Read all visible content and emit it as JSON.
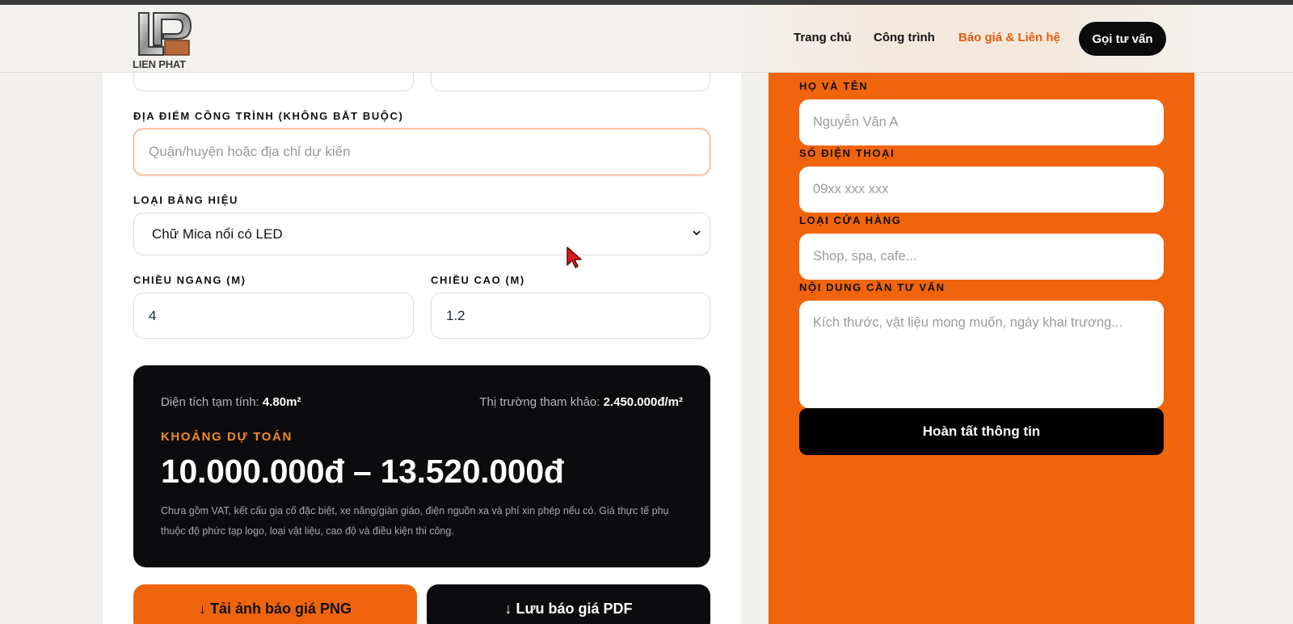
{
  "header": {
    "logo_text": "LIEN PHAT",
    "nav": [
      {
        "label": "Trang chủ"
      },
      {
        "label": "Công trình"
      },
      {
        "label": "Báo giá & Liên hệ"
      }
    ],
    "cta_label": "Gọi tư vấn"
  },
  "form": {
    "location_label": "ĐỊA ĐIỂM CÔNG TRÌNH (KHÔNG BẮT BUỘC)",
    "location_placeholder": "Quận/huyện hoặc địa chỉ dự kiến",
    "sign_type_label": "LOẠI BẢNG HIỆU",
    "sign_type_value": "Chữ Mica nổi có LED",
    "width_label": "CHIỀU NGANG (M)",
    "width_value": "4",
    "height_label": "CHIỀU CAO (M)",
    "height_value": "1.2"
  },
  "estimate": {
    "area_label": "Diện tích tạm tính:",
    "area_value": "4.80m²",
    "market_label": "Thị trường tham khảo:",
    "market_value": "2.450.000đ/m²",
    "title": "KHOẢNG DỰ TOÁN",
    "range": "10.000.000đ – 13.520.000đ",
    "note": "Chưa gồm VAT, kết cấu gia cố đặc biệt, xe nâng/giàn giáo, điện nguồn xa và phí xin phép nếu có. Giá thực tế phụ thuộc độ phức tạp logo, loại vật liệu, cao độ và điều kiện thi công."
  },
  "actions": {
    "png_label": "↓ Tải ảnh báo giá PNG",
    "pdf_label": "↓ Lưu báo giá PDF"
  },
  "contact": {
    "name_label": "HỌ VÀ TÊN",
    "name_placeholder": "Nguyễn Văn A",
    "phone_label": "SỐ ĐIỆN THOẠI",
    "phone_placeholder": "09xx xxx xxx",
    "shop_label": "LOẠI CỬA HÀNG",
    "shop_placeholder": "Shop, spa, cafe...",
    "content_label": "NỘI DUNG CẦN TƯ VẤN",
    "content_placeholder": "Kích thước, vật liệu mong muốn, ngày khai trương...",
    "submit_label": "Hoàn tất thông tin"
  },
  "colors": {
    "accent": "#f0640c",
    "dark": "#0c0c0e",
    "nav_active": "#e85a0c"
  }
}
